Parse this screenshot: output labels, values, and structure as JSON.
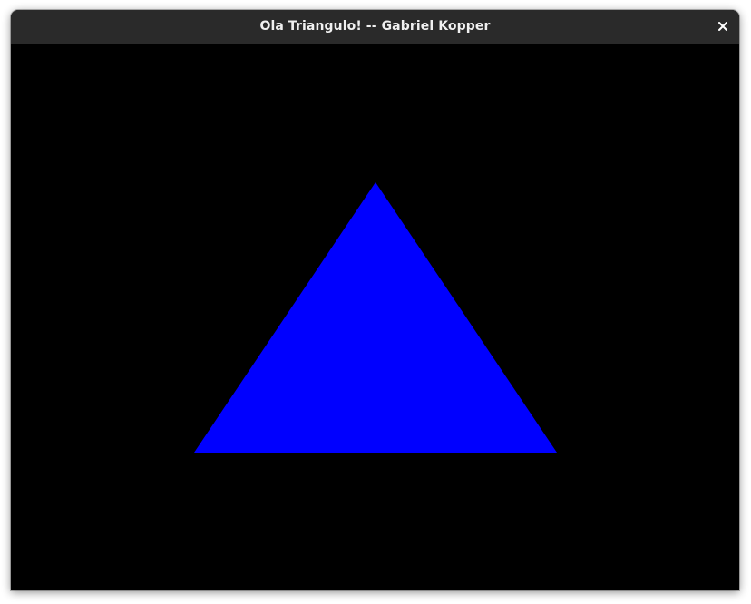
{
  "window": {
    "title": "Ola Triangulo! -- Gabriel Kopper",
    "close_icon": "close-icon"
  },
  "scene": {
    "background_color": "#000000",
    "triangle_color": "#0000ff"
  }
}
